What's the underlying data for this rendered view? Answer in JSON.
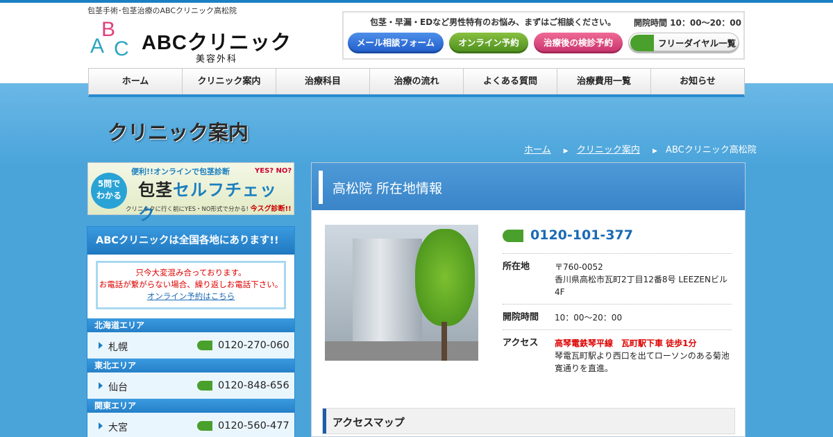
{
  "header": {
    "tagline": "包茎手術･包茎治療のABCクリニック高松院",
    "logo_name": "ABCクリニック",
    "logo_sub": "美容外科",
    "message": "包茎・早漏・EDなど男性特有のお悩み、まずはご相談ください。",
    "hours": "開院時間 10：00～20：00",
    "buttons": {
      "mail": "メール相談フォーム",
      "online": "オンライン予約",
      "checkup": "治療後の検診予約",
      "freedial": "フリーダイヤル一覧"
    }
  },
  "nav": [
    "ホーム",
    "クリニック案内",
    "治療科目",
    "治療の流れ",
    "よくある質問",
    "治療費用一覧",
    "お知らせ"
  ],
  "page_title": "クリニック案内",
  "breadcrumb": {
    "home": "ホーム",
    "clinic": "クリニック案内",
    "current": "ABCクリニック高松院"
  },
  "banner": {
    "circle_line1": "5問で",
    "circle_line2": "わかる",
    "top": "便利!!オンラインで包茎診断",
    "main1": "包茎",
    "main2": "セルフチェック",
    "bottom": "クリニックに行く前にYES・NO形式で分かる!",
    "cta": "今スグ診断!!",
    "yesno": "YES? NO?"
  },
  "sidebar": {
    "header": "ABCクリニックは全国各地にあります!!",
    "notice_line1": "只今大変混み合っております。",
    "notice_line2": "お電話が繋がらない場合、繰り返しお電話下さい。",
    "notice_link": "オンライン予約はこちら",
    "areas": [
      {
        "name": "北海道エリア",
        "city": "札幌",
        "tel": "0120-270-060"
      },
      {
        "name": "東北エリア",
        "city": "仙台",
        "tel": "0120-848-656"
      },
      {
        "name": "関東エリア",
        "city": "大宮",
        "tel": "0120-560-477"
      }
    ]
  },
  "main": {
    "title": "高松院 所在地情報",
    "tel": "0120-101-377",
    "address_label": "所在地",
    "postal": "〒760-0052",
    "address": "香川県高松市瓦町2丁目12番8号 LEEZENビル4F",
    "hours_label": "開院時間",
    "hours": "10：00～20：00",
    "access_label": "アクセス",
    "access_red": "高琴電鉄琴平線　瓦町駅下車 徒歩1分",
    "access_text": "琴電瓦町駅より西口を出てローソンのある菊池寛通りを直進。",
    "map_title": "アクセスマップ"
  },
  "colors": {
    "accent": "#2a8ad0",
    "tel_blue": "#1a6ab4",
    "alert_red": "#dd0000",
    "freedial_green": "#4aa02c"
  }
}
